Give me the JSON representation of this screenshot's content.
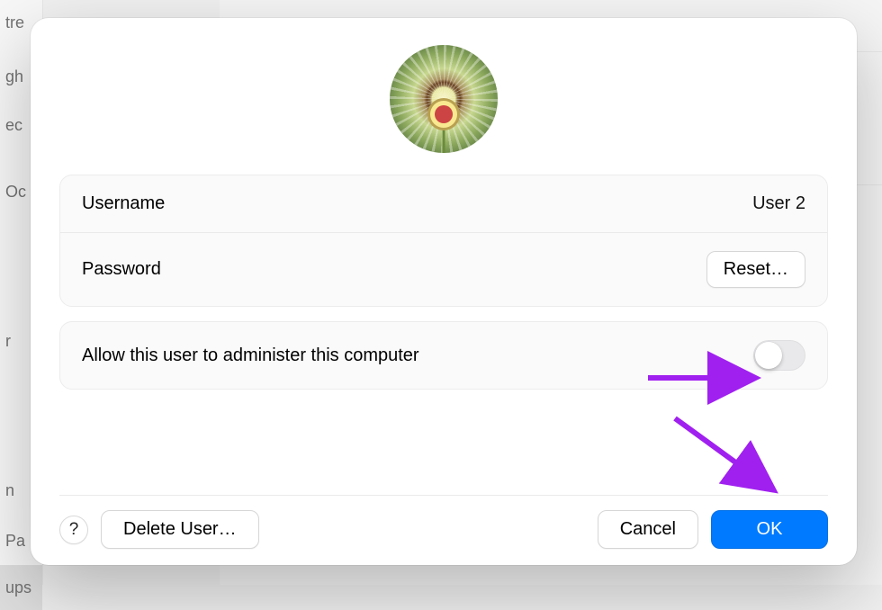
{
  "sidebar_peek": [
    "tre",
    "gh",
    "ec",
    "Oc",
    "r",
    "n",
    "Pa",
    "ups"
  ],
  "user": {
    "avatar_alt": "Dandelion",
    "username_label": "Username",
    "username_value": "User 2",
    "password_label": "Password",
    "password_reset_label": "Reset…"
  },
  "admin": {
    "label": "Allow this user to administer this computer",
    "enabled": false
  },
  "help_glyph": "?",
  "actions": {
    "delete_label": "Delete User…",
    "cancel_label": "Cancel",
    "ok_label": "OK"
  },
  "annotations": {
    "arrow_color": "#a020f0"
  }
}
